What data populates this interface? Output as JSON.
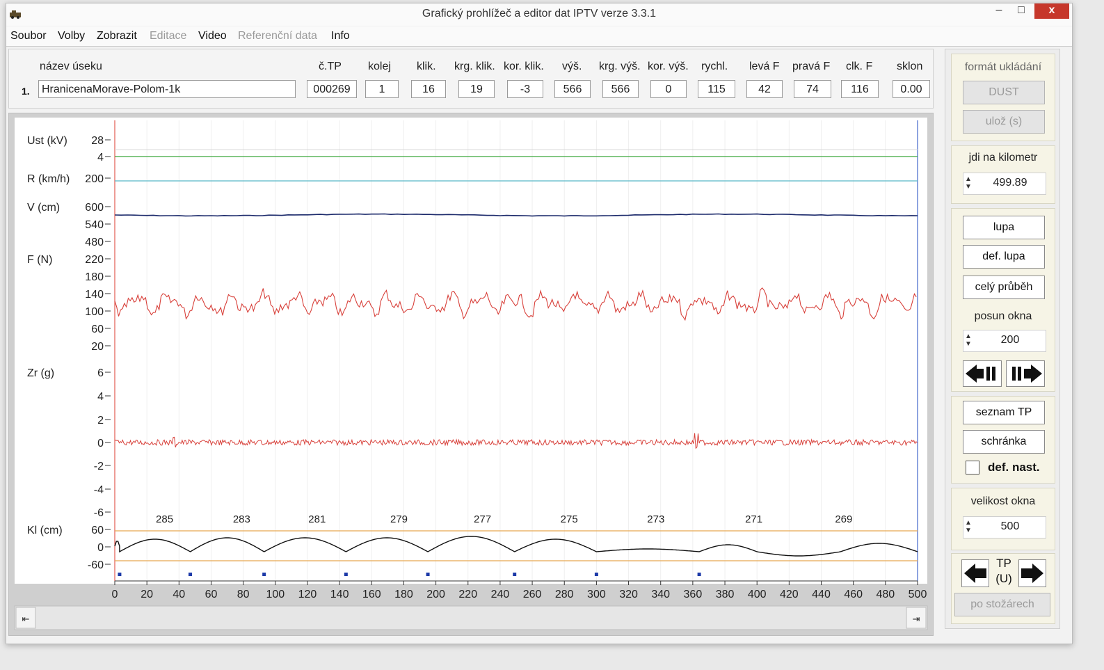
{
  "window": {
    "title": "Grafický prohlížeč a editor dat IPTV verze 3.3.1",
    "min_icon": "minimize-icon",
    "max_icon": "maximize-icon",
    "close_icon": "close-icon",
    "min_glyph": "–",
    "max_glyph": "□",
    "close_glyph": "x"
  },
  "menu": [
    {
      "label": "Soubor",
      "disabled": false
    },
    {
      "label": "Volby",
      "disabled": false
    },
    {
      "label": "Zobrazit",
      "disabled": false
    },
    {
      "label": "Editace",
      "disabled": true
    },
    {
      "label": "Video",
      "disabled": false
    },
    {
      "label": "Referenční data",
      "disabled": true
    },
    {
      "label": "Info",
      "disabled": false
    }
  ],
  "header": {
    "row_number": "1.",
    "name_label": "název úseku",
    "name_value": "HranicenaMorave-Polom-1k",
    "columns": [
      {
        "label": "č.TP",
        "value": "000269"
      },
      {
        "label": "kolej",
        "value": "1"
      },
      {
        "label": "klik.",
        "value": "16"
      },
      {
        "label": "krg. klik.",
        "value": "19"
      },
      {
        "label": "kor. klik.",
        "value": "-3"
      },
      {
        "label": "výš.",
        "value": "566"
      },
      {
        "label": "krg. výš.",
        "value": "566"
      },
      {
        "label": "kor. výš.",
        "value": "0"
      },
      {
        "label": "rychl.",
        "value": "115"
      },
      {
        "label": "levá F",
        "value": "42"
      },
      {
        "label": "pravá F",
        "value": "74"
      },
      {
        "label": "clk. F",
        "value": "116"
      },
      {
        "label": "sklon",
        "value": "0.00"
      }
    ]
  },
  "right_panel": {
    "save_format_label": "formát ukládání",
    "dust_button": "DUST",
    "save_button": "ulož (s)",
    "goto_km_label": "jdi na kilometr",
    "goto_km_value": "499.89",
    "zoom_button": "lupa",
    "def_zoom_button": "def. lupa",
    "full_view_button": "celý průběh",
    "window_shift_label": "posun okna",
    "window_shift_value": "200",
    "shift_left_icon": "shift-left-icon",
    "shift_right_icon": "shift-right-icon",
    "tp_list_button": "seznam TP",
    "clipboard_button": "schránka",
    "def_settings_label": "def. nast.",
    "def_settings_checked": false,
    "window_size_label": "velikost okna",
    "window_size_value": "500",
    "tp_label": "TP",
    "tp_sub_label": "(U)",
    "tp_prev_icon": "arrow-left-icon",
    "tp_next_icon": "arrow-right-icon",
    "masts_button": "po stožárech"
  },
  "chart_data": {
    "type": "line",
    "x_ticks": [
      0,
      20,
      40,
      60,
      80,
      100,
      120,
      140,
      160,
      180,
      200,
      220,
      240,
      260,
      280,
      300,
      320,
      340,
      360,
      380,
      400,
      420,
      440,
      460,
      480,
      500
    ],
    "xlim": [
      0,
      500
    ],
    "panels": [
      {
        "label": "Ust (kV)",
        "ticks": [
          "28",
          "4"
        ],
        "color": "#3aa83a",
        "level": 4
      },
      {
        "label": "R (km/h)",
        "ticks": [
          "200"
        ],
        "color": "#58b8c8",
        "level": 200
      },
      {
        "label": "V (cm)",
        "ticks": [
          "600",
          "540",
          "480"
        ],
        "color": "#1c2a6b",
        "level": 566
      },
      {
        "label": "F (N)",
        "ticks": [
          "220",
          "180",
          "140",
          "100",
          "60",
          "20"
        ],
        "color": "#d8403a",
        "level": 116
      },
      {
        "label": "Zr (g)",
        "ticks": [
          "6",
          "4",
          "2",
          "0",
          "-2",
          "-4",
          "-6"
        ],
        "color": "#d8403a",
        "level": 0
      },
      {
        "label": "Kl (cm)",
        "ticks": [
          "60",
          "0",
          "-60"
        ],
        "color": "#111111",
        "level": 0
      }
    ],
    "mast_labels": [
      {
        "x": 31,
        "label": "285"
      },
      {
        "x": 79,
        "label": "283"
      },
      {
        "x": 126,
        "label": "281"
      },
      {
        "x": 177,
        "label": "279"
      },
      {
        "x": 229,
        "label": "277"
      },
      {
        "x": 283,
        "label": "275"
      },
      {
        "x": 337,
        "label": "273"
      },
      {
        "x": 398,
        "label": "271"
      },
      {
        "x": 454,
        "label": "269"
      }
    ],
    "mast_positions": [
      3,
      47,
      93,
      144,
      195,
      249,
      300,
      364
    ],
    "scrollbar": {
      "left_icon": "scroll-left-icon",
      "right_icon": "scroll-right-icon"
    }
  }
}
